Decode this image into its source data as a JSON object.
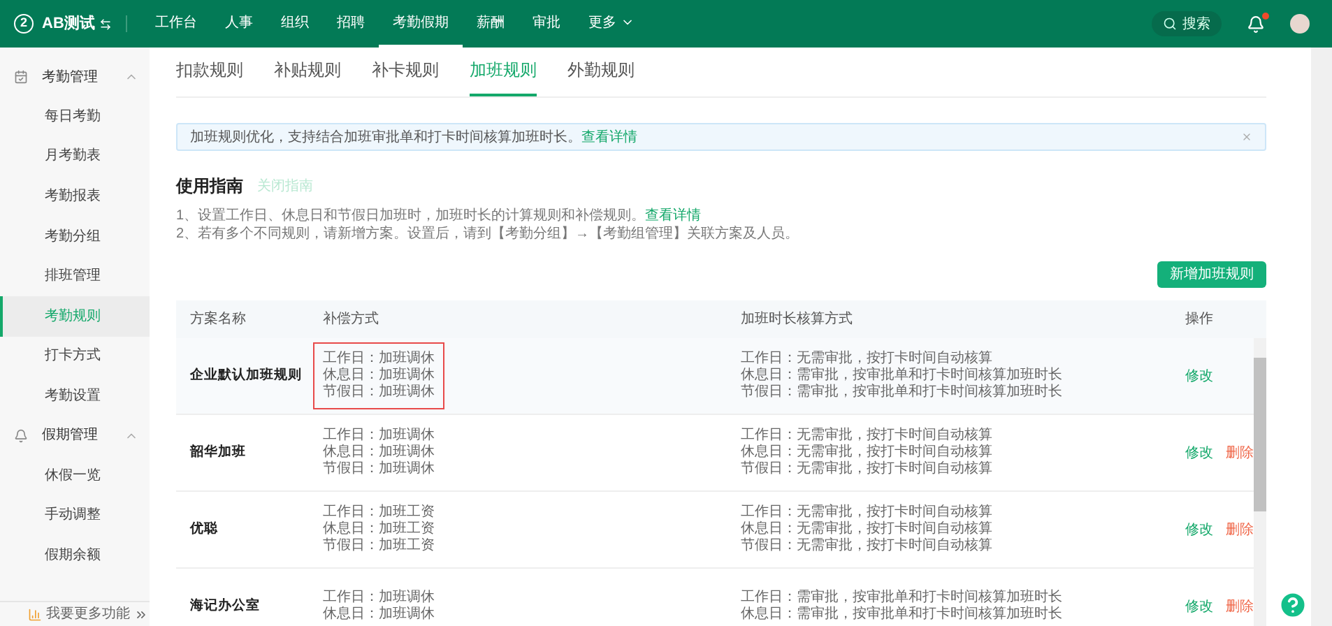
{
  "header": {
    "logo": "2",
    "org": "AB测试",
    "nav": [
      {
        "label": "工作台",
        "selected": false
      },
      {
        "label": "人事",
        "selected": false
      },
      {
        "label": "组织",
        "selected": false
      },
      {
        "label": "招聘",
        "selected": false
      },
      {
        "label": "考勤假期",
        "selected": true
      },
      {
        "label": "薪酬",
        "selected": false
      },
      {
        "label": "审批",
        "selected": false
      },
      {
        "label": "更多",
        "selected": false
      }
    ],
    "search": "搜索",
    "notification_dot": true
  },
  "sidebar": {
    "groups": [
      {
        "label": "考勤管理",
        "expanded": true,
        "children": [
          {
            "label": "每日考勤",
            "selected": false
          },
          {
            "label": "月考勤表",
            "selected": false
          },
          {
            "label": "考勤报表",
            "selected": false
          },
          {
            "label": "考勤分组",
            "selected": false
          },
          {
            "label": "排班管理",
            "selected": false
          },
          {
            "label": "考勤规则",
            "selected": true
          },
          {
            "label": "打卡方式",
            "selected": false
          },
          {
            "label": "考勤设置",
            "selected": false
          }
        ]
      },
      {
        "label": "假期管理",
        "expanded": true,
        "children": [
          {
            "label": "休假一览",
            "selected": false
          },
          {
            "label": "手动调整",
            "selected": false
          },
          {
            "label": "假期余额",
            "selected": false
          }
        ]
      }
    ],
    "footer": "我要更多功能"
  },
  "tabs": [
    {
      "label": "扣款规则",
      "selected": false
    },
    {
      "label": "补贴规则",
      "selected": false
    },
    {
      "label": "补卡规则",
      "selected": false
    },
    {
      "label": "加班规则",
      "selected": true
    },
    {
      "label": "外勤规则",
      "selected": false
    }
  ],
  "notice": {
    "text": "加班规则优化，支持结合加班审批单和打卡时间核算加班时长。",
    "link": "查看详情"
  },
  "guide": {
    "title": "使用指南",
    "close": "关闭指南",
    "lines": [
      {
        "text": "1、设置工作日、休息日和节假日加班时，加班时长的计算规则和补偿规则。",
        "link": "查看详情"
      },
      {
        "text": "2、若有多个不同规则，请新增方案。设置后，请到【考勤分组】→【考勤组管理】关联方案及人员。"
      }
    ]
  },
  "add_button": "新增加班规则",
  "table": {
    "columns": [
      "方案名称",
      "补偿方式",
      "加班时长核算方式",
      "操作"
    ],
    "rows": [
      {
        "name": "企业默认加班规则",
        "highlighted": true,
        "compensation": [
          "工作日：加班调休",
          "休息日：加班调休",
          "节假日：加班调休"
        ],
        "calculation": [
          "工作日：无需审批，按打卡时间自动核算",
          "休息日：需审批，按审批单和打卡时间核算加班时长",
          "节假日：需审批，按审批单和打卡时间核算加班时长"
        ],
        "actions": [
          {
            "kind": "edit",
            "label": "修改"
          }
        ]
      },
      {
        "name": "韶华加班",
        "highlighted": false,
        "compensation": [
          "工作日：加班调休",
          "休息日：加班调休",
          "节假日：加班调休"
        ],
        "calculation": [
          "工作日：无需审批，按打卡时间自动核算",
          "休息日：无需审批，按打卡时间自动核算",
          "节假日：无需审批，按打卡时间自动核算"
        ],
        "actions": [
          {
            "kind": "edit",
            "label": "修改"
          },
          {
            "kind": "delete",
            "label": "删除"
          }
        ]
      },
      {
        "name": "优聪",
        "highlighted": false,
        "compensation": [
          "工作日：加班工资",
          "休息日：加班工资",
          "节假日：加班工资"
        ],
        "calculation": [
          "工作日：无需审批，按打卡时间自动核算",
          "休息日：无需审批，按打卡时间自动核算",
          "节假日：无需审批，按打卡时间自动核算"
        ],
        "actions": [
          {
            "kind": "edit",
            "label": "修改"
          },
          {
            "kind": "delete",
            "label": "删除"
          }
        ]
      },
      {
        "name": "海记办公室",
        "highlighted": false,
        "compensation": [
          "工作日：加班调休",
          "休息日：加班调休"
        ],
        "calculation": [
          "工作日：需审批，按审批单和打卡时间核算加班时长",
          "休息日：需审批，按审批单和打卡时间核算加班时长"
        ],
        "actions": [
          {
            "kind": "edit",
            "label": "修改"
          },
          {
            "kind": "delete",
            "label": "删除"
          }
        ]
      }
    ]
  }
}
